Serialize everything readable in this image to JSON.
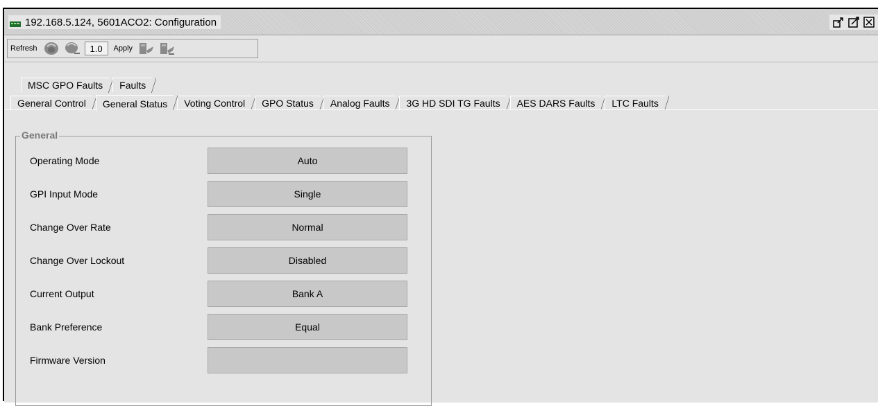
{
  "window": {
    "title": "192.168.5.124, 5601ACO2: Configuration",
    "icons": [
      "device-icon",
      "undock-icon",
      "maximize-icon",
      "close-icon"
    ]
  },
  "toolbar": {
    "refresh_label": "Refresh",
    "zoom_value": "1.0",
    "apply_label": "Apply",
    "icons": [
      "refresh-device-icon",
      "refresh-device-alt-icon",
      "apply-icon",
      "apply-alt-icon"
    ]
  },
  "tabs": {
    "row1": [
      "MSC GPO Faults",
      "Faults"
    ],
    "row2": [
      "General Control",
      "General Status",
      "Voting Control",
      "GPO Status",
      "Analog Faults",
      "3G HD SDI TG Faults",
      "AES DARS Faults",
      "LTC Faults"
    ],
    "active": "General Status"
  },
  "general": {
    "title": "General",
    "rows": [
      {
        "label": "Operating Mode",
        "value": "Auto"
      },
      {
        "label": "GPI Input Mode",
        "value": "Single"
      },
      {
        "label": "Change Over Rate",
        "value": "Normal"
      },
      {
        "label": "Change Over Lockout",
        "value": "Disabled"
      },
      {
        "label": "Current Output",
        "value": "Bank A"
      },
      {
        "label": "Bank Preference",
        "value": "Equal"
      },
      {
        "label": "Firmware Version",
        "value": ""
      }
    ]
  },
  "colors": {
    "background": "#e4e4e4",
    "field": "#c8c8c8",
    "group_title": "#7a7a7a"
  }
}
